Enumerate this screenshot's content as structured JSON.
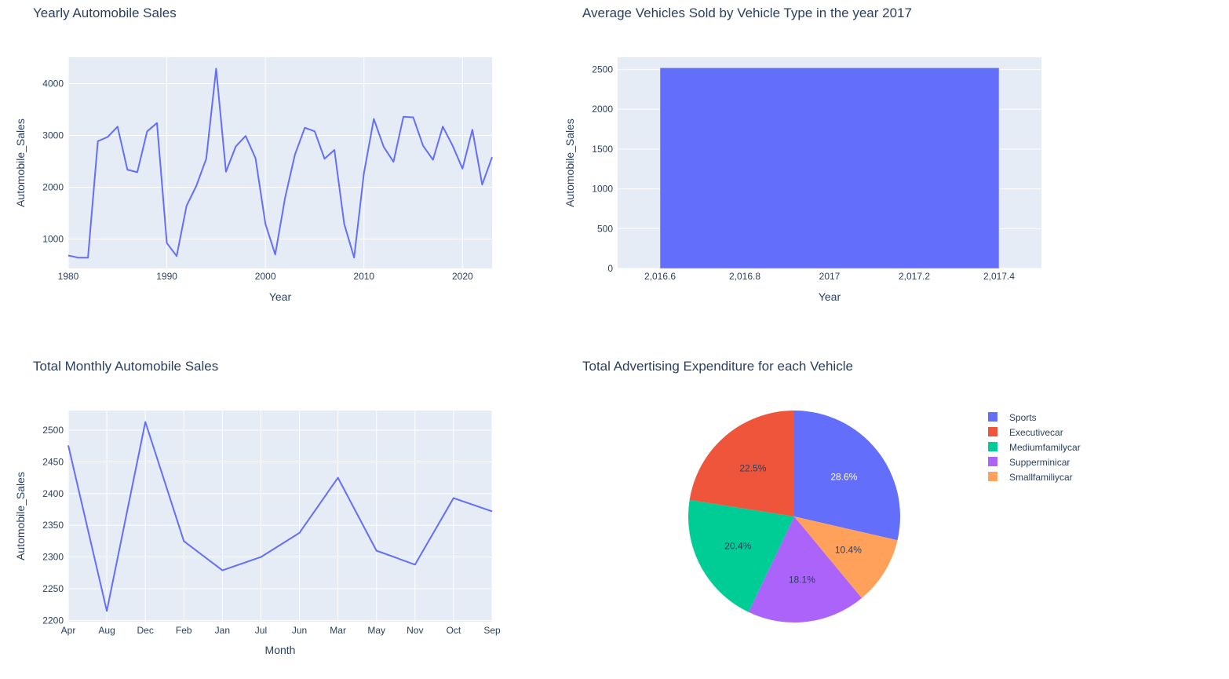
{
  "chart_data": [
    {
      "type": "line",
      "title": "Yearly Automobile Sales",
      "xlabel": "Year",
      "ylabel": "Automobile_Sales",
      "color": "#636efa",
      "xlim": [
        1980,
        2023
      ],
      "ylim": [
        430,
        4510
      ],
      "xticks": [
        1980,
        1990,
        2000,
        2010,
        2020
      ],
      "yticks": [
        1000,
        2000,
        3000,
        4000
      ],
      "x": [
        1980,
        1981,
        1982,
        1983,
        1984,
        1985,
        1986,
        1987,
        1988,
        1989,
        1990,
        1991,
        1992,
        1993,
        1994,
        1995,
        1996,
        1997,
        1998,
        1999,
        2000,
        2001,
        2002,
        2003,
        2004,
        2005,
        2006,
        2007,
        2008,
        2009,
        2010,
        2011,
        2012,
        2013,
        2014,
        2015,
        2016,
        2017,
        2018,
        2019,
        2020,
        2021,
        2022,
        2023
      ],
      "y": [
        680,
        640,
        640,
        2890,
        2970,
        3170,
        2340,
        2290,
        3080,
        3240,
        920,
        670,
        1640,
        2030,
        2550,
        4290,
        2300,
        2790,
        2990,
        2560,
        1290,
        700,
        1800,
        2630,
        3150,
        3080,
        2550,
        2720,
        1290,
        640,
        2270,
        3320,
        2780,
        2490,
        3360,
        3350,
        2800,
        2530,
        3170,
        2800,
        2360,
        3110,
        2050,
        2580
      ]
    },
    {
      "type": "bar",
      "title": "Average Vehicles Sold by Vehicle Type in the year 2017",
      "xlabel": "Year",
      "ylabel": "Automobile_Sales",
      "color": "#636efa",
      "categories": [
        2017
      ],
      "values": [
        2520
      ],
      "xlim": [
        2016.5,
        2017.5
      ],
      "ylim": [
        0,
        2652
      ],
      "xticks": [
        2016.6,
        2016.8,
        2017,
        2017.2,
        2017.4
      ],
      "xtick_labels": [
        "2,016.6",
        "2,016.8",
        "2017",
        "2,017.2",
        "2,017.4"
      ],
      "yticks": [
        0,
        500,
        1000,
        1500,
        2000,
        2500
      ]
    },
    {
      "type": "line",
      "title": "Total Monthly Automobile Sales",
      "xlabel": "Month",
      "ylabel": "Automobile_Sales",
      "color": "#636efa",
      "categories": [
        "Apr",
        "Aug",
        "Dec",
        "Feb",
        "Jan",
        "Jul",
        "Jun",
        "Mar",
        "May",
        "Nov",
        "Oct",
        "Sep"
      ],
      "values": [
        2476,
        2215,
        2513,
        2325,
        2279,
        2300,
        2338,
        2425,
        2310,
        2288,
        2393,
        2372
      ],
      "ylim": [
        2198,
        2531
      ],
      "yticks": [
        2200,
        2250,
        2300,
        2350,
        2400,
        2450,
        2500
      ]
    },
    {
      "type": "pie",
      "title": "Total Advertising Expenditure for each Vehicle",
      "labels": [
        "Sports",
        "Executivecar",
        "Mediumfamilycar",
        "Supperminicar",
        "Smallfamiliycar"
      ],
      "values": [
        28.6,
        22.5,
        20.4,
        18.1,
        10.4
      ],
      "percent_labels": [
        "28.6%",
        "22.5%",
        "20.4%",
        "18.1%",
        "10.4%"
      ],
      "colors": [
        "#636efa",
        "#ef553b",
        "#00cc96",
        "#ab63fa",
        "#ffa15a"
      ],
      "legend_position": "right"
    }
  ]
}
